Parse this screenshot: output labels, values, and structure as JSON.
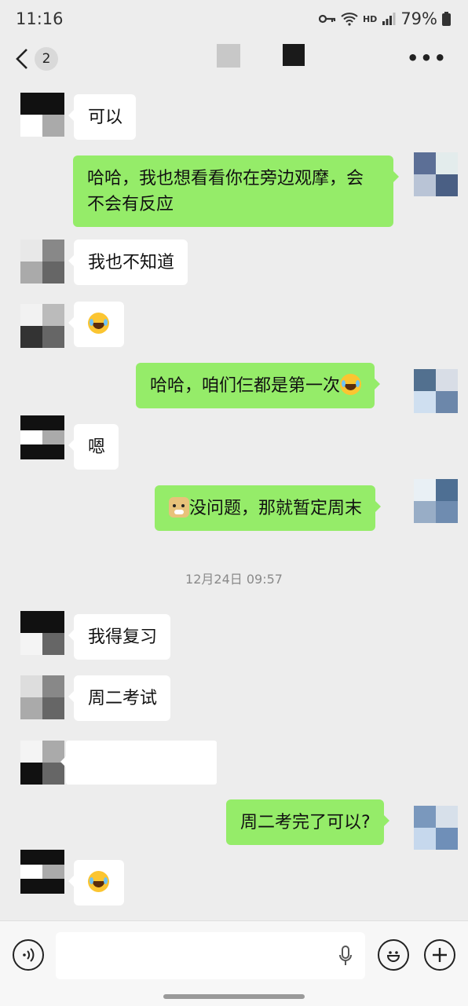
{
  "status_bar": {
    "time": "11:16",
    "net": "HD",
    "battery": "79%"
  },
  "nav": {
    "badge_count": "2",
    "more_label": "•••"
  },
  "messages": [
    {
      "dir": "in",
      "text": "可以"
    },
    {
      "dir": "out",
      "text": "哈哈，我也想看看你在旁边观摩，会不会有反应"
    },
    {
      "dir": "in",
      "text": "我也不知道"
    },
    {
      "dir": "in",
      "text": "",
      "emoji": "laugh-cry-emoji"
    },
    {
      "dir": "out",
      "text": "哈哈，咱们仨都是第一次",
      "emoji": "laugh-cry-emoji"
    },
    {
      "dir": "in",
      "text": "嗯"
    },
    {
      "dir": "out",
      "text": "没问题，那就暂定周末",
      "emoji": "doge-emoji"
    },
    {
      "dir": "in",
      "text": "我得复习"
    },
    {
      "dir": "in",
      "text": "周二考试"
    },
    {
      "dir": "in",
      "text": ""
    },
    {
      "dir": "out",
      "text": "周二考完了可以?"
    },
    {
      "dir": "in",
      "text": "",
      "emoji": "laugh-cry-emoji"
    }
  ],
  "timestamp": "12月24日 09:57",
  "colors": {
    "outgoing_bubble": "#95ec69",
    "incoming_bubble": "#ffffff",
    "background": "#ededed"
  },
  "icons": {
    "back": "back-arrow-icon",
    "voice": "voice-icon",
    "mic": "microphone-icon",
    "emoji": "emoji-icon",
    "plus": "plus-icon"
  }
}
